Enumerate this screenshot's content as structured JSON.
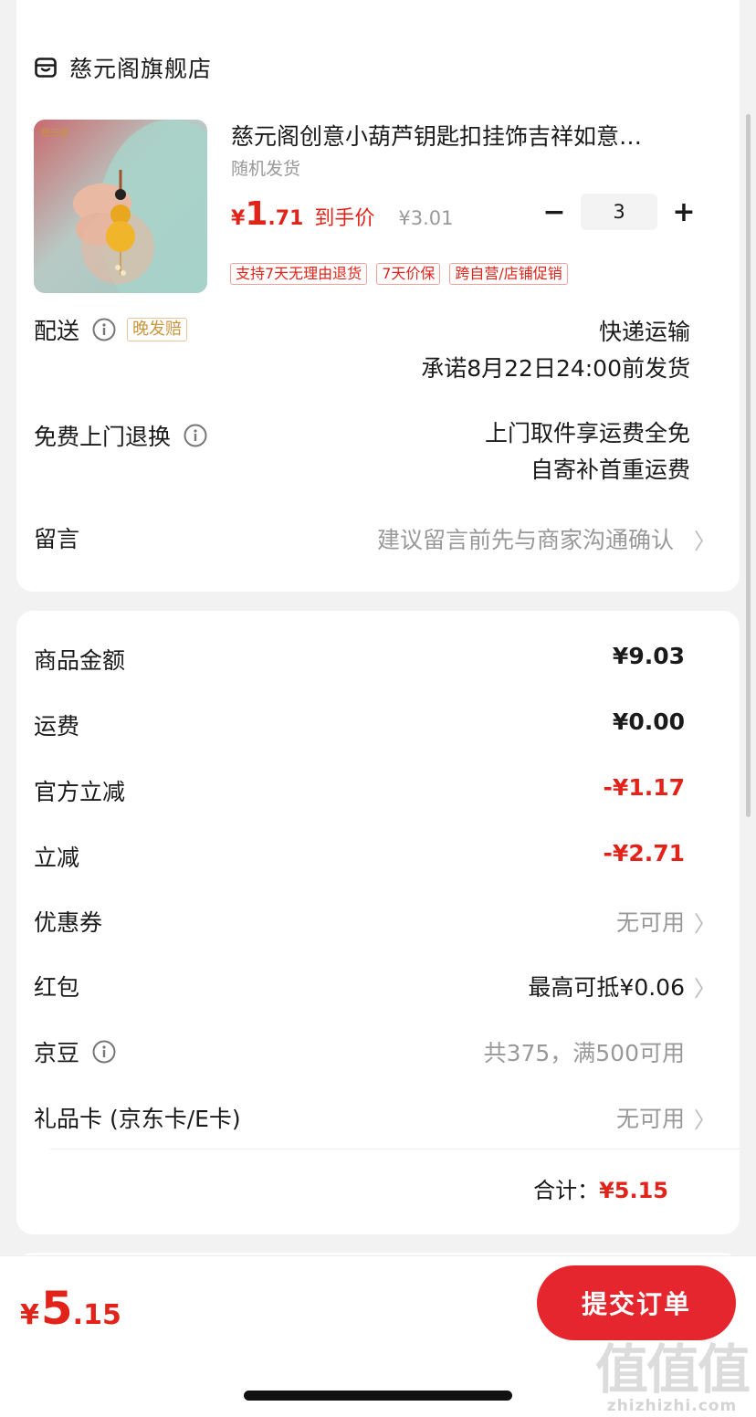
{
  "shop": {
    "name": "慈元阁旗舰店",
    "icon": "shop-icon"
  },
  "product": {
    "title": "慈元阁创意小葫芦钥匙扣挂饰吉祥如意…",
    "spec": "随机发货",
    "price_symbol": "¥",
    "price_int": "1",
    "price_dec": ".71",
    "price_tag": "到手价",
    "original_price": "¥3.01",
    "quantity": "3",
    "minus": "−",
    "plus": "+",
    "tags": [
      "支持7天无理由退货",
      "7天价保",
      "跨自营/店铺促销"
    ],
    "thumb_logo": "慈元阁"
  },
  "delivery": {
    "label": "配送",
    "badge": "晚发赔",
    "method": "快递运输",
    "promise": "承诺8月22日24:00前发货"
  },
  "returns": {
    "label": "免费上门退换",
    "line1": "上门取件享运费全免",
    "line2": "自寄补首重运费"
  },
  "message": {
    "label": "留言",
    "placeholder": "建议留言前先与商家沟通确认"
  },
  "summary": {
    "rows": [
      {
        "label": "商品金额",
        "value": "¥9.03"
      },
      {
        "label": "运费",
        "value": "¥0.00"
      },
      {
        "label": "官方立减",
        "value": "-¥1.17"
      },
      {
        "label": "立减",
        "value": "-¥2.71"
      },
      {
        "label": "优惠券",
        "value": "无可用"
      },
      {
        "label": "红包",
        "value": "最高可抵¥0.06"
      },
      {
        "label": "京豆",
        "value": "共375，满500可用"
      },
      {
        "label": "礼品卡 (京东卡/E卡)",
        "value": "无可用"
      }
    ],
    "total_label": "合计：",
    "total_value": "¥5.15"
  },
  "bottom": {
    "price_symbol": "¥",
    "price_int": "5",
    "price_dec": ".15",
    "submit_label": "提交订单"
  },
  "watermark": {
    "glyphs": "值值值",
    "domain": "zhizhizhi.com"
  },
  "colors": {
    "accent_red": "#e2231a",
    "submit_red": "#e5262e",
    "badge_gold": "#c8963e"
  }
}
